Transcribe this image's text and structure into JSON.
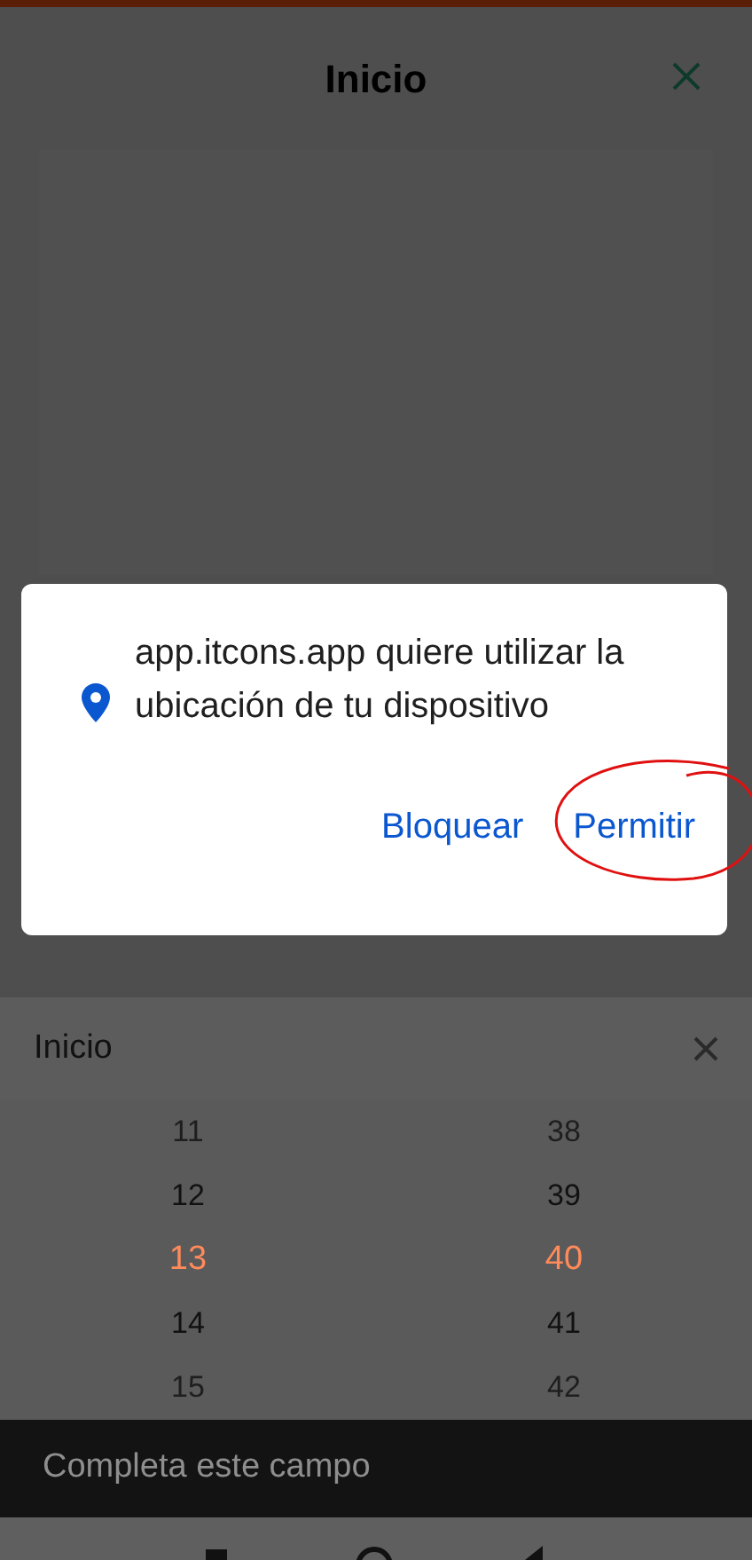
{
  "header": {
    "title": "Inicio"
  },
  "permission_dialog": {
    "message": "app.itcons.app quiere utilizar la ubicación de tu dispositivo",
    "buttons": [
      {
        "label": "Bloquear",
        "circled": false
      },
      {
        "label": "Permitir",
        "circled": true
      }
    ]
  },
  "picker": {
    "title": "Inicio",
    "hours": [
      {
        "label": "11",
        "selected": false
      },
      {
        "label": "12",
        "selected": false
      },
      {
        "label": "13",
        "selected": true
      },
      {
        "label": "14",
        "selected": false
      },
      {
        "label": "15",
        "selected": false
      }
    ],
    "minutes": [
      {
        "label": "38",
        "selected": false
      },
      {
        "label": "39",
        "selected": false
      },
      {
        "label": "40",
        "selected": true
      },
      {
        "label": "41",
        "selected": false
      },
      {
        "label": "42",
        "selected": false
      }
    ]
  },
  "snackbar": {
    "message": "Completa este campo"
  }
}
